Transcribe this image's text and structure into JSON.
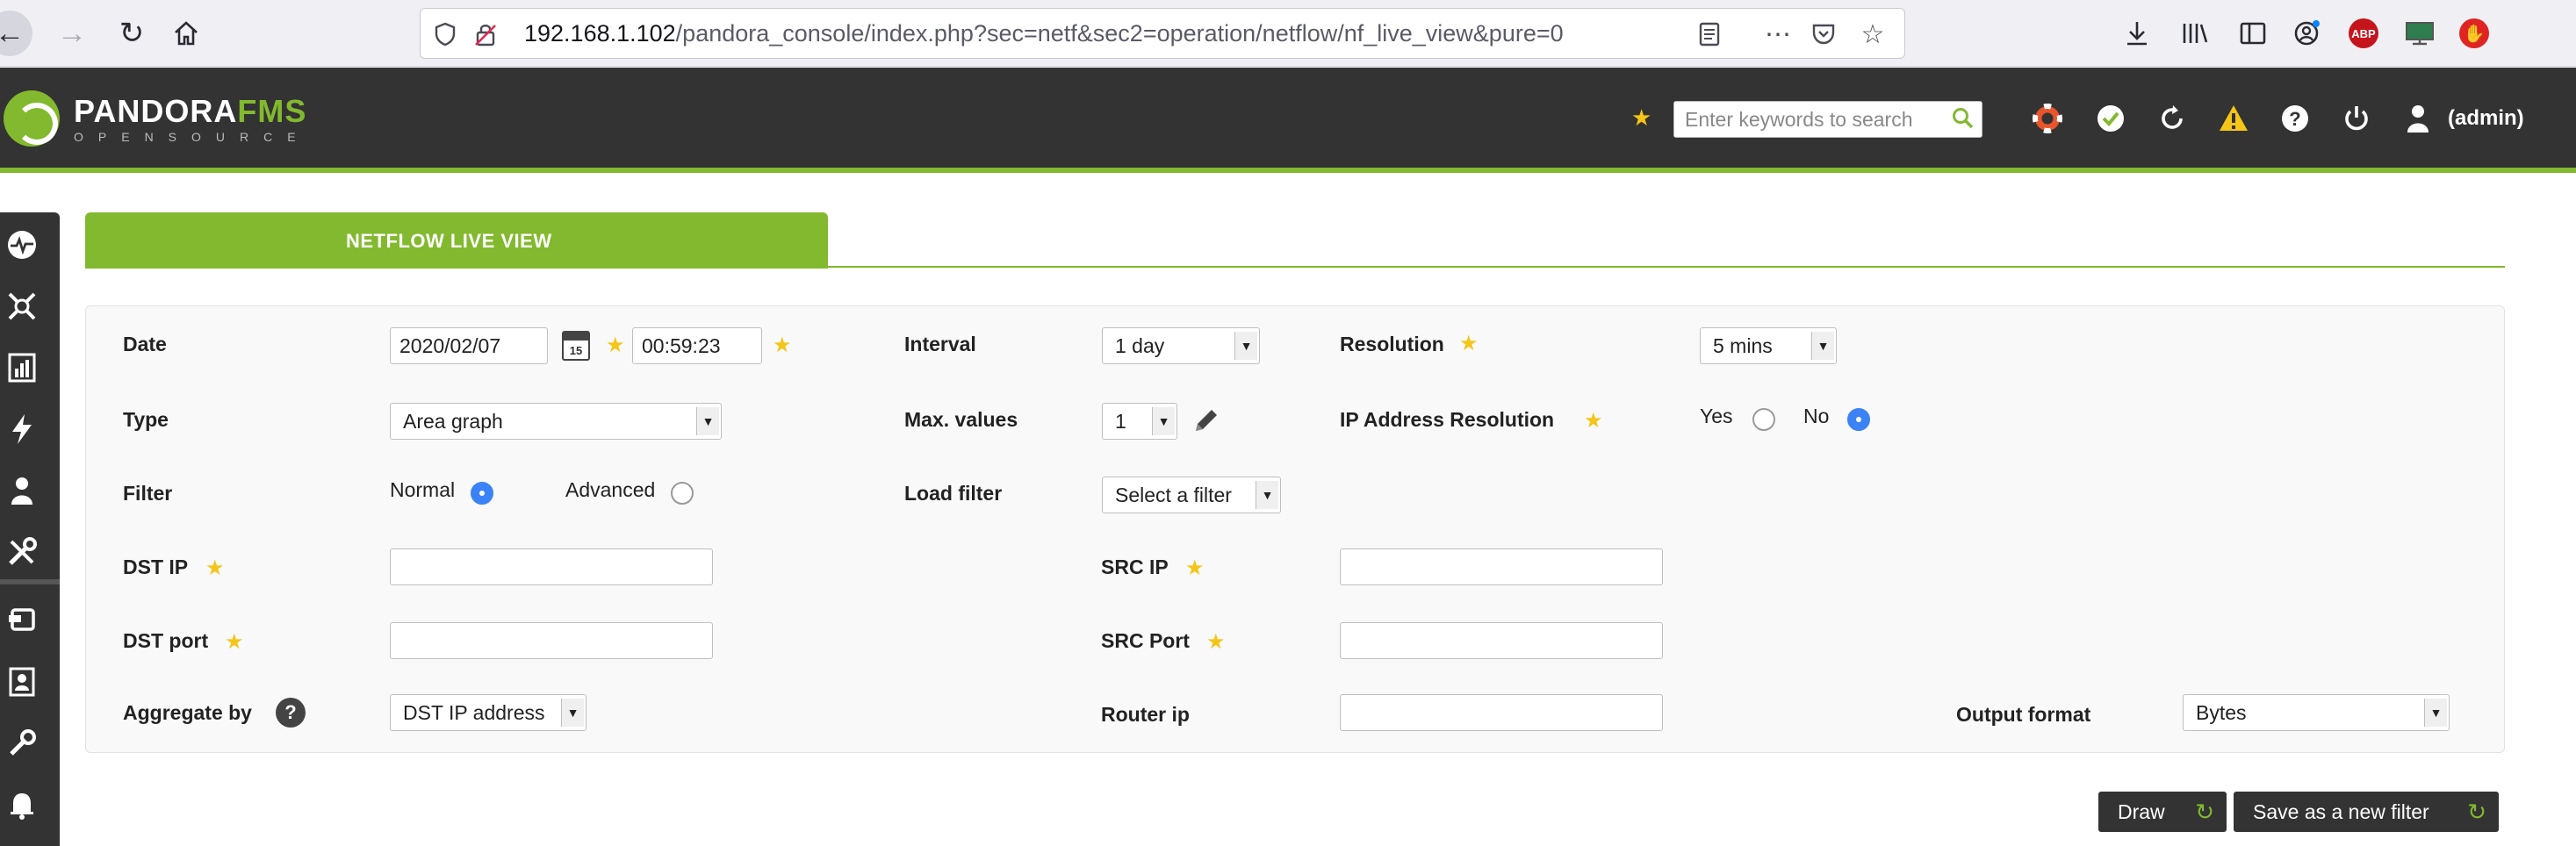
{
  "browser": {
    "url_host": "192.168.1.102",
    "url_path": "/pandora_console/index.php?sec=netf&sec2=operation/netflow/nf_live_view&pure=0",
    "abp_label": "ABP"
  },
  "header": {
    "logo_title_a": "PANDORA",
    "logo_title_b": "FMS",
    "logo_subtitle": "OPENSOURCE",
    "search_placeholder": "Enter keywords to search",
    "user_label": "(admin)"
  },
  "tab": {
    "label": "NETFLOW LIVE VIEW"
  },
  "form": {
    "date_label": "Date",
    "date_value": "2020/02/07",
    "calendar_day": "15",
    "time_value": "00:59:23",
    "interval_label": "Interval",
    "interval_value": "1 day",
    "resolution_label": "Resolution",
    "resolution_value": "5 mins",
    "type_label": "Type",
    "type_value": "Area graph",
    "max_values_label": "Max. values",
    "max_values_value": "1",
    "ip_resolution_label": "IP Address Resolution",
    "yes_label": "Yes",
    "no_label": "No",
    "filter_label": "Filter",
    "normal_label": "Normal",
    "advanced_label": "Advanced",
    "load_filter_label": "Load filter",
    "load_filter_value": "Select a filter",
    "dst_ip_label": "DST IP",
    "src_ip_label": "SRC IP",
    "dst_port_label": "DST port",
    "src_port_label": "SRC Port",
    "aggregate_label": "Aggregate by",
    "aggregate_value": "DST IP address",
    "router_ip_label": "Router ip",
    "output_format_label": "Output format",
    "output_format_value": "Bytes"
  },
  "buttons": {
    "draw": "Draw",
    "save_filter": "Save as a new filter"
  },
  "colors": {
    "accent": "#82b92e",
    "header_bg": "#333333",
    "radio_selected": "#3b82f6",
    "star": "#f5c518"
  }
}
